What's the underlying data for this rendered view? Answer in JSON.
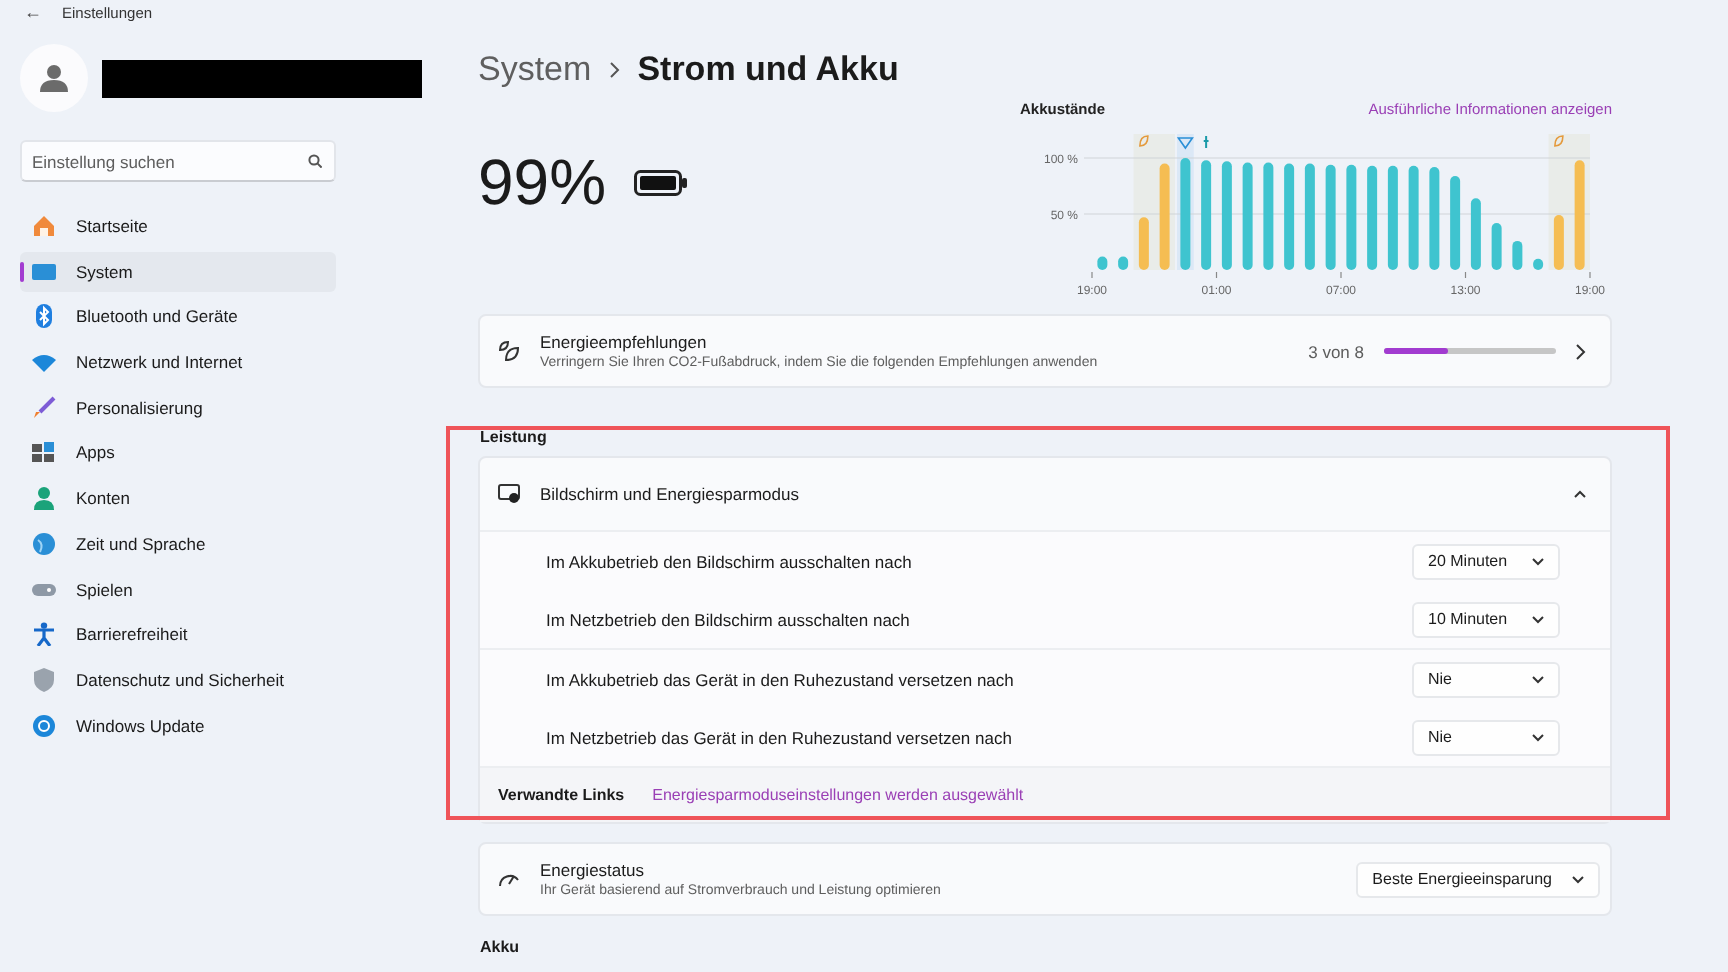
{
  "window": {
    "back_glyph": "←",
    "title": "Einstellungen"
  },
  "sidebar": {
    "search": {
      "placeholder": "Einstellung suchen"
    },
    "items": [
      {
        "label": "Startseite",
        "selected": false
      },
      {
        "label": "System",
        "selected": true
      },
      {
        "label": "Bluetooth und Geräte",
        "selected": false
      },
      {
        "label": "Netzwerk und Internet",
        "selected": false
      },
      {
        "label": "Personalisierung",
        "selected": false
      },
      {
        "label": "Apps",
        "selected": false
      },
      {
        "label": "Konten",
        "selected": false
      },
      {
        "label": "Zeit und Sprache",
        "selected": false
      },
      {
        "label": "Spielen",
        "selected": false
      },
      {
        "label": "Barrierefreiheit",
        "selected": false
      },
      {
        "label": "Datenschutz und Sicherheit",
        "selected": false
      },
      {
        "label": "Windows Update",
        "selected": false
      }
    ]
  },
  "breadcrumb": [
    "System",
    "Strom und Akku"
  ],
  "battery": {
    "percent": "99%"
  },
  "battery_chart": {
    "title": "Akkustände",
    "link": "Ausführliche Informationen anzeigen",
    "chart_data": {
      "type": "bar",
      "categories": [
        "19:00",
        null,
        null,
        null,
        null,
        null,
        "01:00",
        null,
        null,
        null,
        null,
        null,
        "07:00",
        null,
        null,
        null,
        null,
        null,
        "13:00",
        null,
        null,
        null,
        null,
        null,
        "19:00"
      ],
      "ylim": [
        0,
        100
      ],
      "yticks": [
        {
          "value": 50,
          "label": "50 %"
        },
        {
          "value": 100,
          "label": "100 %"
        }
      ],
      "series": [
        {
          "color": "#3fc4cf",
          "values": [
            12,
            12,
            null,
            null,
            100,
            98,
            97,
            96,
            96,
            95,
            95,
            94,
            94,
            93,
            93,
            93,
            92,
            84,
            64,
            42,
            26,
            10,
            null,
            null,
            null
          ]
        },
        {
          "color": "#f5bd52",
          "values": [
            null,
            null,
            47,
            95,
            null,
            null,
            null,
            null,
            null,
            null,
            null,
            null,
            null,
            null,
            null,
            null,
            null,
            null,
            null,
            null,
            null,
            null,
            49,
            98,
            null
          ]
        }
      ]
    }
  },
  "recommendations": {
    "title": "Energieempfehlungen",
    "subtitle": "Verringern Sie Ihren CO2-Fußabdruck, indem Sie die folgenden Empfehlungen anwenden",
    "count": "3 von 8",
    "level": 0.375
  },
  "performance": {
    "heading": "Leistung",
    "expander": {
      "title": "Bildschirm und Energiesparmodus",
      "expanded": true,
      "settings": [
        {
          "label": "Im Akkubetrieb den Bildschirm ausschalten nach",
          "value": "20 Minuten"
        },
        {
          "label": "Im Netzbetrieb den Bildschirm ausschalten nach",
          "value": "10 Minuten"
        },
        {
          "label": "Im Akkubetrieb das Gerät in den Ruhezustand versetzen nach",
          "value": "Nie"
        },
        {
          "label": "Im Netzbetrieb das Gerät in den Ruhezustand versetzen nach",
          "value": "Nie"
        }
      ],
      "related_links_label": "Verwandte Links",
      "related_link": "Energiesparmoduseinstellungen werden ausgewählt"
    },
    "power_mode": {
      "title": "Energiestatus",
      "subtitle": "Ihr Gerät basierend auf Stromverbrauch und Leistung optimieren",
      "value": "Beste Energieeinsparung"
    }
  },
  "battery_section": {
    "heading": "Akku"
  }
}
